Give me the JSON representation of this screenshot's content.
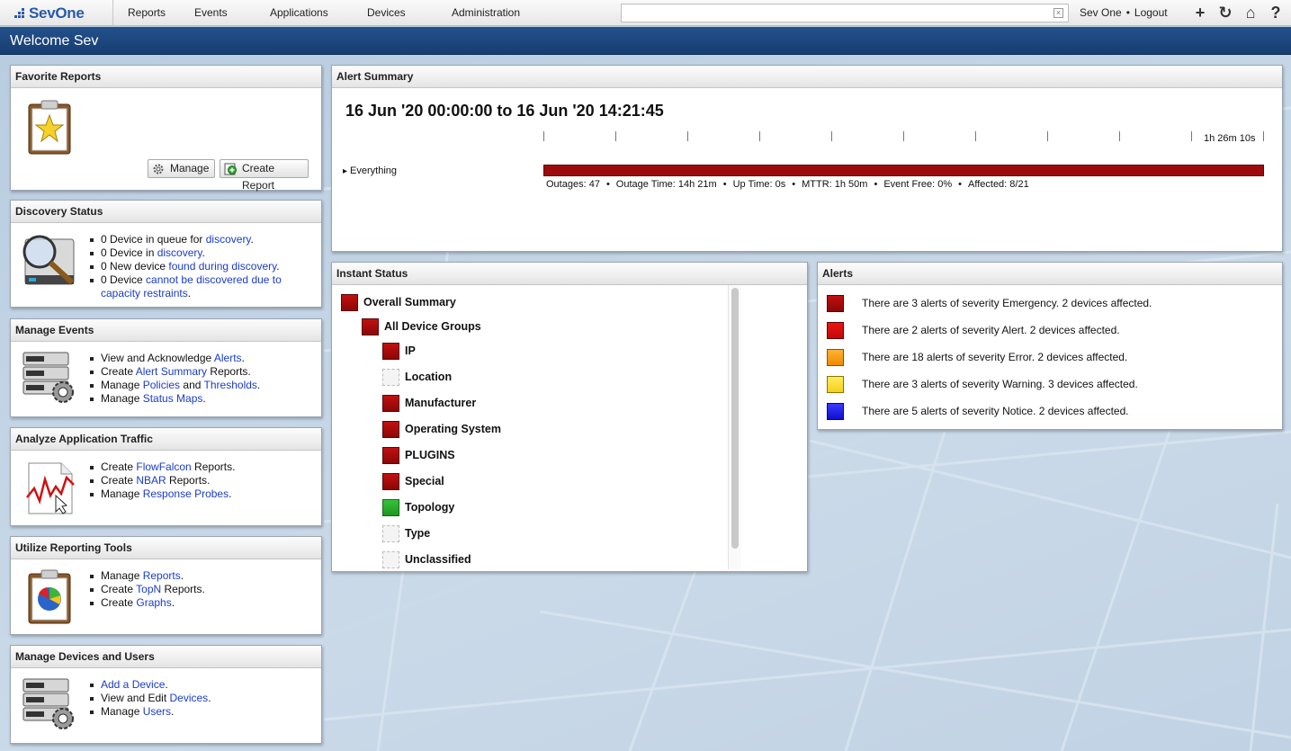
{
  "brand": {
    "logo_text": "SevOne"
  },
  "nav": {
    "items": [
      "Reports",
      "Events",
      "Applications",
      "Devices",
      "Administration"
    ]
  },
  "search": {
    "value": "",
    "placeholder": ""
  },
  "user": {
    "name": "Sev One",
    "logout": "Logout"
  },
  "tools": {
    "add": "+",
    "refresh": "↻",
    "home": "⌂",
    "help": "?"
  },
  "welcome": "Welcome Sev",
  "favorite_reports": {
    "title": "Favorite Reports",
    "manage_label": "Manage",
    "create_label": "Create Report"
  },
  "discovery": {
    "title": "Discovery Status",
    "items": [
      {
        "text": "0 Device in queue for ",
        "link": "discovery",
        "tail": "."
      },
      {
        "text": "0 Device in ",
        "link": "discovery",
        "tail": "."
      },
      {
        "text": "0 New device ",
        "link": "found during discovery",
        "tail": "."
      },
      {
        "text": "0 Device ",
        "link": "cannot be discovered due to",
        "link2": "capacity restraints",
        "tail": "."
      }
    ]
  },
  "manage_events": {
    "title": "Manage Events",
    "items": [
      {
        "text": "View and Acknowledge ",
        "link": "Alerts",
        "tail": "."
      },
      {
        "text": "Create ",
        "link": "Alert Summary",
        "tail": " Reports."
      },
      {
        "text": "Manage ",
        "link": "Policies",
        "mid": " and ",
        "link2": "Thresholds",
        "tail": "."
      },
      {
        "text": "Manage ",
        "link": "Status Maps",
        "tail": "."
      }
    ]
  },
  "app_traffic": {
    "title": "Analyze Application Traffic",
    "items": [
      {
        "text": "Create ",
        "link": "FlowFalcon",
        "tail": " Reports."
      },
      {
        "text": "Create ",
        "link": "NBAR",
        "tail": " Reports."
      },
      {
        "text": "Manage ",
        "link": "Response Probes",
        "tail": "."
      }
    ]
  },
  "reporting_tools": {
    "title": "Utilize Reporting Tools",
    "items": [
      {
        "text": "Manage ",
        "link": "Reports",
        "tail": "."
      },
      {
        "text": "Create ",
        "link": "TopN",
        "tail": " Reports."
      },
      {
        "text": "Create ",
        "link": "Graphs",
        "tail": "."
      }
    ]
  },
  "devices_users": {
    "title": "Manage Devices and Users",
    "items": [
      {
        "text": "",
        "link": "Add a Device",
        "tail": "."
      },
      {
        "text": "View and Edit ",
        "link": "Devices",
        "tail": "."
      },
      {
        "text": "Manage ",
        "link": "Users",
        "tail": "."
      }
    ]
  },
  "alert_summary": {
    "title": "Alert Summary",
    "range": "16 Jun '20 00:00:00 to 16 Jun '20 14:21:45",
    "duration": "1h 26m 10s",
    "row_label": "Everything",
    "bar_color": "#9c0b0b",
    "stats": [
      "Outages: 47",
      "Outage Time: 14h 21m",
      "Up Time: 0s",
      "MTTR: 1h 50m",
      "Event Free: 0%",
      "Affected: 8/21"
    ]
  },
  "instant_status": {
    "title": "Instant Status",
    "items": [
      {
        "label": "Overall Summary",
        "status": "red",
        "level": 0
      },
      {
        "label": "All Device Groups",
        "status": "red",
        "level": 1
      },
      {
        "label": "IP",
        "status": "red",
        "level": 2
      },
      {
        "label": "Location",
        "status": "empty",
        "level": 2
      },
      {
        "label": "Manufacturer",
        "status": "red",
        "level": 2
      },
      {
        "label": "Operating System",
        "status": "red",
        "level": 2
      },
      {
        "label": "PLUGINS",
        "status": "red",
        "level": 2
      },
      {
        "label": "Special",
        "status": "red",
        "level": 2
      },
      {
        "label": "Topology",
        "status": "green",
        "level": 2
      },
      {
        "label": "Type",
        "status": "empty",
        "level": 2
      },
      {
        "label": "Unclassified",
        "status": "empty",
        "level": 2
      }
    ]
  },
  "alerts": {
    "title": "Alerts",
    "items": [
      {
        "severity": "emerg",
        "color": "#b00c0c",
        "text": "There are 3 alerts of severity Emergency. 2 devices affected."
      },
      {
        "severity": "alert",
        "color": "#e01010",
        "text": "There are 2 alerts of severity Alert. 2 devices affected."
      },
      {
        "severity": "error",
        "color": "#f5a01a",
        "text": "There are 18 alerts of severity Error. 2 devices affected."
      },
      {
        "severity": "warn",
        "color": "#f9de3a",
        "text": "There are 3 alerts of severity Warning. 3 devices affected."
      },
      {
        "severity": "notice",
        "color": "#1a1ae8",
        "text": "There are 5 alerts of severity Notice. 2 devices affected."
      }
    ]
  }
}
